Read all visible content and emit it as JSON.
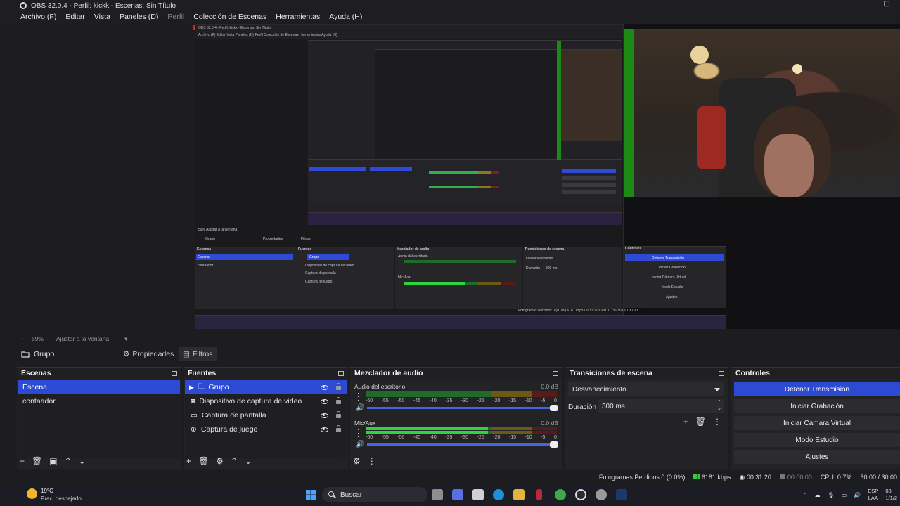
{
  "window": {
    "title": "OBS 32.0.4 - Perfil: kickk - Escenas: Sin Título",
    "controls": [
      "–",
      "▢"
    ]
  },
  "menu": {
    "items": [
      "Archivo (F)",
      "Editar",
      "Vista",
      "Paneles (D)",
      "Perfil",
      "Colección de Escenas",
      "Herramientas",
      "Ayuda (H)"
    ]
  },
  "preview_nested": {
    "title": "OBS 32.0.4 - Perfil: kickk - Escenas: Sin Título",
    "menu": "Archivo (F)   Editar   Vista   Paneles (D)   Perfil   Colección de Escenas   Herramientas   Ayuda (H)",
    "group": "Grupo",
    "propiedades": "Propiedades",
    "filtros": "Filtros",
    "escenas_hdr": "Escenas",
    "fuentes_hdr": "Fuentes",
    "mezclador_hdr": "Mezclador de audio",
    "transiciones_hdr": "Transiciones de escena",
    "controles_hdr": "Controles",
    "scene_sel": "Escena",
    "scene2": "contaador",
    "src1": "Grupo",
    "src2": "Dispositivo de captura de video",
    "src3": "Captura de pantalla",
    "src4": "Captura de juego",
    "mix1": "Audio del escritorio",
    "mix2": "Mic/Aux",
    "trans": "Desvanecimiento",
    "dur": "Duración",
    "dur_val": "300 ms",
    "c1": "Detener Transmisión",
    "c2": "Iniciar Grabación",
    "c3": "Iniciar Cámara Virtual",
    "c4": "Modo Estudio",
    "c5": "Ajustes",
    "status": "Fotogramas Perdidos 0 (0.0%)   6181 kbps   00:31:20   CPU: 0.7%   30.00 / 30.00",
    "zoom": "59%   Ajustar a la ventana"
  },
  "zoom_toolbar": {
    "minus": "−",
    "zoom": "59%",
    "fit": "Ajustar a la ventana",
    "caret": "▾"
  },
  "source_toolbar": {
    "selected_source": "Grupo",
    "properties_label": "Propiedades",
    "filters_label": "Filtros"
  },
  "scenes": {
    "header": "Escenas",
    "items": [
      "Escena",
      "contaador"
    ],
    "selected": 0
  },
  "sources": {
    "header": "Fuentes",
    "items": [
      {
        "name": "Grupo",
        "icon": "folder-icon"
      },
      {
        "name": "Dispositivo de captura de video",
        "icon": "camera-icon"
      },
      {
        "name": "Captura de pantalla",
        "icon": "monitor-icon"
      },
      {
        "name": "Captura de juego",
        "icon": "gamepad-icon"
      }
    ],
    "selected": 0
  },
  "mixer": {
    "header": "Mezclador de audio",
    "channels": [
      {
        "name": "Audio del escritorio",
        "db": "0.0 dB",
        "level": 0
      },
      {
        "name": "Mic/Aux",
        "db": "0.0 dB",
        "level": 0.64
      }
    ],
    "ticks": [
      "-60",
      "-55",
      "-50",
      "-45",
      "-40",
      "-35",
      "-30",
      "-25",
      "-20",
      "-15",
      "-10",
      "-5",
      "0"
    ]
  },
  "transitions": {
    "header": "Transiciones de escena",
    "selected": "Desvanecimiento",
    "duration_label": "Duración",
    "duration_value": "300 ms"
  },
  "controls": {
    "header": "Controles",
    "buttons": [
      "Detener Transmisión",
      "Iniciar Grabación",
      "Iniciar Cámara Virtual",
      "Modo Estudio",
      "Ajustes"
    ]
  },
  "status": {
    "dropped": "Fotogramas Perdidos 0 (0.0%)",
    "bitrate": "6181 kbps",
    "stream_time": "00:31:20",
    "rec_time": "00:00:00",
    "cpu": "CPU: 0.7%",
    "fps": "30.00 / 30.00"
  },
  "taskbar": {
    "temp": "19°C",
    "weather": "Prac. despejado",
    "search": "Buscar",
    "lang1": "ESP",
    "lang2": "LAA",
    "time": "08",
    "date": "1/1/2"
  },
  "colors": {
    "accent": "#2d4ad5",
    "meter_green": "#2dd43c",
    "webcam_green": "#1d8a16"
  }
}
